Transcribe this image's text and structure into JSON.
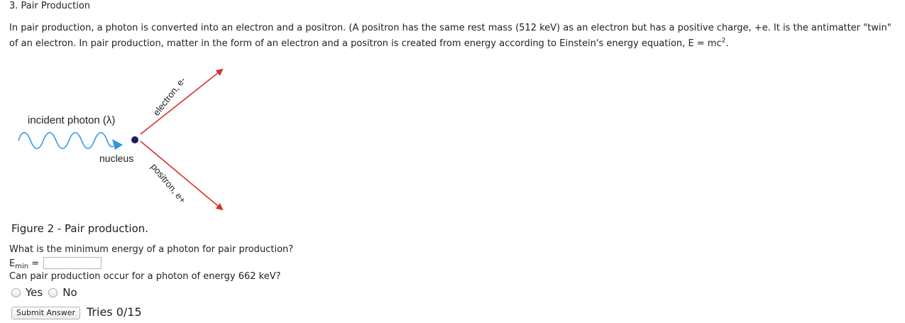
{
  "question": {
    "title": "3. Pair Production",
    "intro": "In pair production, a photon is converted into an electron and a positron. (A positron has the same rest mass (512 keV) as an electron but has a positive charge, +e. It is the antimatter \"twin\" of an electron. In pair production, matter in the form of an electron and a positron is created from energy according to Einstein's energy equation, E = mc",
    "intro_sup": "2",
    "intro_end": "."
  },
  "figure": {
    "photon_label": "incident photon (λ)",
    "nucleus_label": "nucleus",
    "electron_label": "electron, e-",
    "positron_label": "positron, e+",
    "caption": "Figure 2 - Pair production.",
    "colors": {
      "photon": "#2f95e0",
      "tracks": "#d6322a",
      "nucleus": "#1d1d5e"
    }
  },
  "part1": {
    "prompt": "What is the minimum energy of a photon for pair production?",
    "label_main": "E",
    "label_sub": "min",
    "label_eq": " =",
    "value": ""
  },
  "part2": {
    "prompt": "Can pair production occur for a photon of energy 662 keV?",
    "options": [
      "Yes",
      "No"
    ]
  },
  "footer": {
    "submit_label": "Submit Answer",
    "tries": "Tries 0/15"
  }
}
